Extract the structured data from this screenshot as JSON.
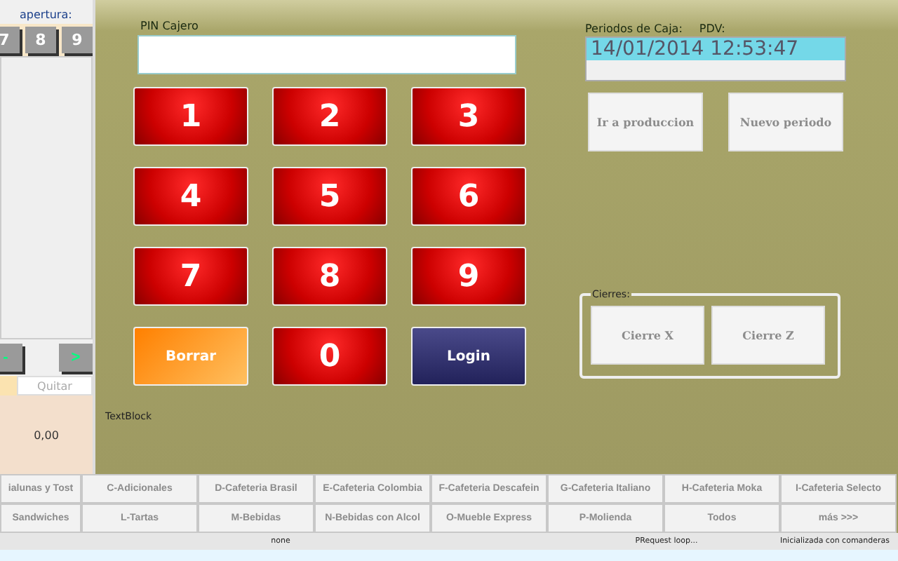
{
  "left_panel": {
    "label": "apertura:",
    "keys": [
      "7",
      "8",
      "9"
    ],
    "nav_buttons": [
      "-",
      ">"
    ],
    "remove_button": "Quitar",
    "total": "0,00"
  },
  "pin": {
    "label": "PIN Cajero"
  },
  "keypad": [
    {
      "kind": "digit",
      "label": "1"
    },
    {
      "kind": "digit",
      "label": "2"
    },
    {
      "kind": "digit",
      "label": "3"
    },
    {
      "kind": "digit",
      "label": "4"
    },
    {
      "kind": "digit",
      "label": "5"
    },
    {
      "kind": "digit",
      "label": "6"
    },
    {
      "kind": "digit",
      "label": "7"
    },
    {
      "kind": "digit",
      "label": "8"
    },
    {
      "kind": "digit",
      "label": "9"
    },
    {
      "kind": "clear",
      "label": "Borrar"
    },
    {
      "kind": "digit",
      "label": "0"
    },
    {
      "kind": "login",
      "label": "Login"
    }
  ],
  "periods": {
    "label": "Periodos de Caja:",
    "pdv_label": "PDV:",
    "items": [
      {
        "text": "14/01/2014 12:53:47",
        "selected": true
      }
    ],
    "buttons": [
      "Ir a produccion",
      "Nuevo periodo"
    ]
  },
  "closings": {
    "label": "Cierres:",
    "buttons": [
      "Cierre X",
      "Cierre Z"
    ]
  },
  "textblock": "TextBlock",
  "categories": [
    [
      "ialunas y Tost",
      "C-Adicionales",
      "D-Cafeteria Brasil",
      "E-Cafeteria Colombia",
      "F-Cafeteria Descafein",
      "G-Cafeteria Italiano",
      "H-Cafeteria Moka",
      "I-Cafeteria Selecto"
    ],
    [
      "Sandwiches",
      "L-Tartas",
      "M-Bebidas",
      "N-Bebidas con Alcol",
      "O-Mueble Express",
      "P-Molienda",
      "Todos",
      "más >>>"
    ]
  ],
  "status_bar": [
    "none",
    "PRequest loop...",
    "Inicializada con comanderas"
  ]
}
